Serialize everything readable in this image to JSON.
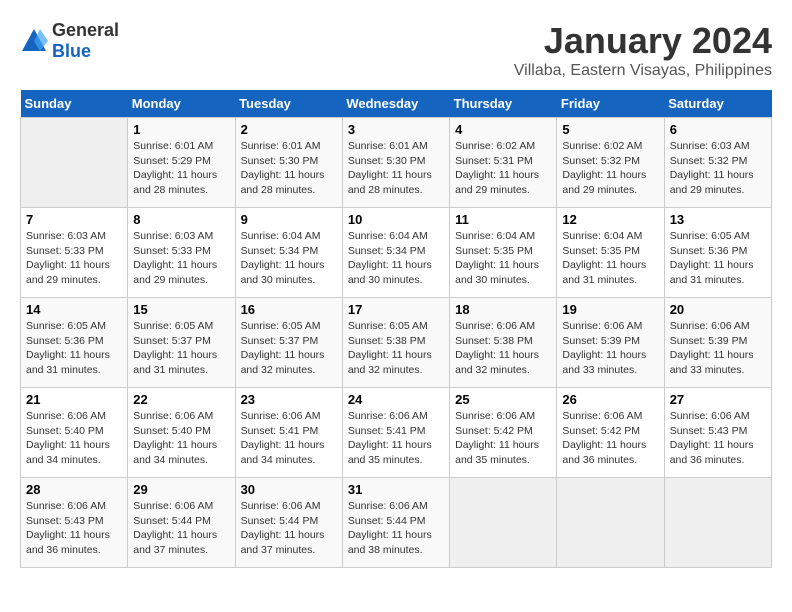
{
  "header": {
    "logo_general": "General",
    "logo_blue": "Blue",
    "month_year": "January 2024",
    "location": "Villaba, Eastern Visayas, Philippines"
  },
  "days_of_week": [
    "Sunday",
    "Monday",
    "Tuesday",
    "Wednesday",
    "Thursday",
    "Friday",
    "Saturday"
  ],
  "weeks": [
    [
      {
        "day": "",
        "sunrise": "",
        "sunset": "",
        "daylight": ""
      },
      {
        "day": "1",
        "sunrise": "6:01 AM",
        "sunset": "5:29 PM",
        "daylight": "11 hours and 28 minutes."
      },
      {
        "day": "2",
        "sunrise": "6:01 AM",
        "sunset": "5:30 PM",
        "daylight": "11 hours and 28 minutes."
      },
      {
        "day": "3",
        "sunrise": "6:01 AM",
        "sunset": "5:30 PM",
        "daylight": "11 hours and 28 minutes."
      },
      {
        "day": "4",
        "sunrise": "6:02 AM",
        "sunset": "5:31 PM",
        "daylight": "11 hours and 29 minutes."
      },
      {
        "day": "5",
        "sunrise": "6:02 AM",
        "sunset": "5:32 PM",
        "daylight": "11 hours and 29 minutes."
      },
      {
        "day": "6",
        "sunrise": "6:03 AM",
        "sunset": "5:32 PM",
        "daylight": "11 hours and 29 minutes."
      }
    ],
    [
      {
        "day": "7",
        "sunrise": "6:03 AM",
        "sunset": "5:33 PM",
        "daylight": "11 hours and 29 minutes."
      },
      {
        "day": "8",
        "sunrise": "6:03 AM",
        "sunset": "5:33 PM",
        "daylight": "11 hours and 29 minutes."
      },
      {
        "day": "9",
        "sunrise": "6:04 AM",
        "sunset": "5:34 PM",
        "daylight": "11 hours and 30 minutes."
      },
      {
        "day": "10",
        "sunrise": "6:04 AM",
        "sunset": "5:34 PM",
        "daylight": "11 hours and 30 minutes."
      },
      {
        "day": "11",
        "sunrise": "6:04 AM",
        "sunset": "5:35 PM",
        "daylight": "11 hours and 30 minutes."
      },
      {
        "day": "12",
        "sunrise": "6:04 AM",
        "sunset": "5:35 PM",
        "daylight": "11 hours and 31 minutes."
      },
      {
        "day": "13",
        "sunrise": "6:05 AM",
        "sunset": "5:36 PM",
        "daylight": "11 hours and 31 minutes."
      }
    ],
    [
      {
        "day": "14",
        "sunrise": "6:05 AM",
        "sunset": "5:36 PM",
        "daylight": "11 hours and 31 minutes."
      },
      {
        "day": "15",
        "sunrise": "6:05 AM",
        "sunset": "5:37 PM",
        "daylight": "11 hours and 31 minutes."
      },
      {
        "day": "16",
        "sunrise": "6:05 AM",
        "sunset": "5:37 PM",
        "daylight": "11 hours and 32 minutes."
      },
      {
        "day": "17",
        "sunrise": "6:05 AM",
        "sunset": "5:38 PM",
        "daylight": "11 hours and 32 minutes."
      },
      {
        "day": "18",
        "sunrise": "6:06 AM",
        "sunset": "5:38 PM",
        "daylight": "11 hours and 32 minutes."
      },
      {
        "day": "19",
        "sunrise": "6:06 AM",
        "sunset": "5:39 PM",
        "daylight": "11 hours and 33 minutes."
      },
      {
        "day": "20",
        "sunrise": "6:06 AM",
        "sunset": "5:39 PM",
        "daylight": "11 hours and 33 minutes."
      }
    ],
    [
      {
        "day": "21",
        "sunrise": "6:06 AM",
        "sunset": "5:40 PM",
        "daylight": "11 hours and 34 minutes."
      },
      {
        "day": "22",
        "sunrise": "6:06 AM",
        "sunset": "5:40 PM",
        "daylight": "11 hours and 34 minutes."
      },
      {
        "day": "23",
        "sunrise": "6:06 AM",
        "sunset": "5:41 PM",
        "daylight": "11 hours and 34 minutes."
      },
      {
        "day": "24",
        "sunrise": "6:06 AM",
        "sunset": "5:41 PM",
        "daylight": "11 hours and 35 minutes."
      },
      {
        "day": "25",
        "sunrise": "6:06 AM",
        "sunset": "5:42 PM",
        "daylight": "11 hours and 35 minutes."
      },
      {
        "day": "26",
        "sunrise": "6:06 AM",
        "sunset": "5:42 PM",
        "daylight": "11 hours and 36 minutes."
      },
      {
        "day": "27",
        "sunrise": "6:06 AM",
        "sunset": "5:43 PM",
        "daylight": "11 hours and 36 minutes."
      }
    ],
    [
      {
        "day": "28",
        "sunrise": "6:06 AM",
        "sunset": "5:43 PM",
        "daylight": "11 hours and 36 minutes."
      },
      {
        "day": "29",
        "sunrise": "6:06 AM",
        "sunset": "5:44 PM",
        "daylight": "11 hours and 37 minutes."
      },
      {
        "day": "30",
        "sunrise": "6:06 AM",
        "sunset": "5:44 PM",
        "daylight": "11 hours and 37 minutes."
      },
      {
        "day": "31",
        "sunrise": "6:06 AM",
        "sunset": "5:44 PM",
        "daylight": "11 hours and 38 minutes."
      },
      {
        "day": "",
        "sunrise": "",
        "sunset": "",
        "daylight": ""
      },
      {
        "day": "",
        "sunrise": "",
        "sunset": "",
        "daylight": ""
      },
      {
        "day": "",
        "sunrise": "",
        "sunset": "",
        "daylight": ""
      }
    ]
  ]
}
